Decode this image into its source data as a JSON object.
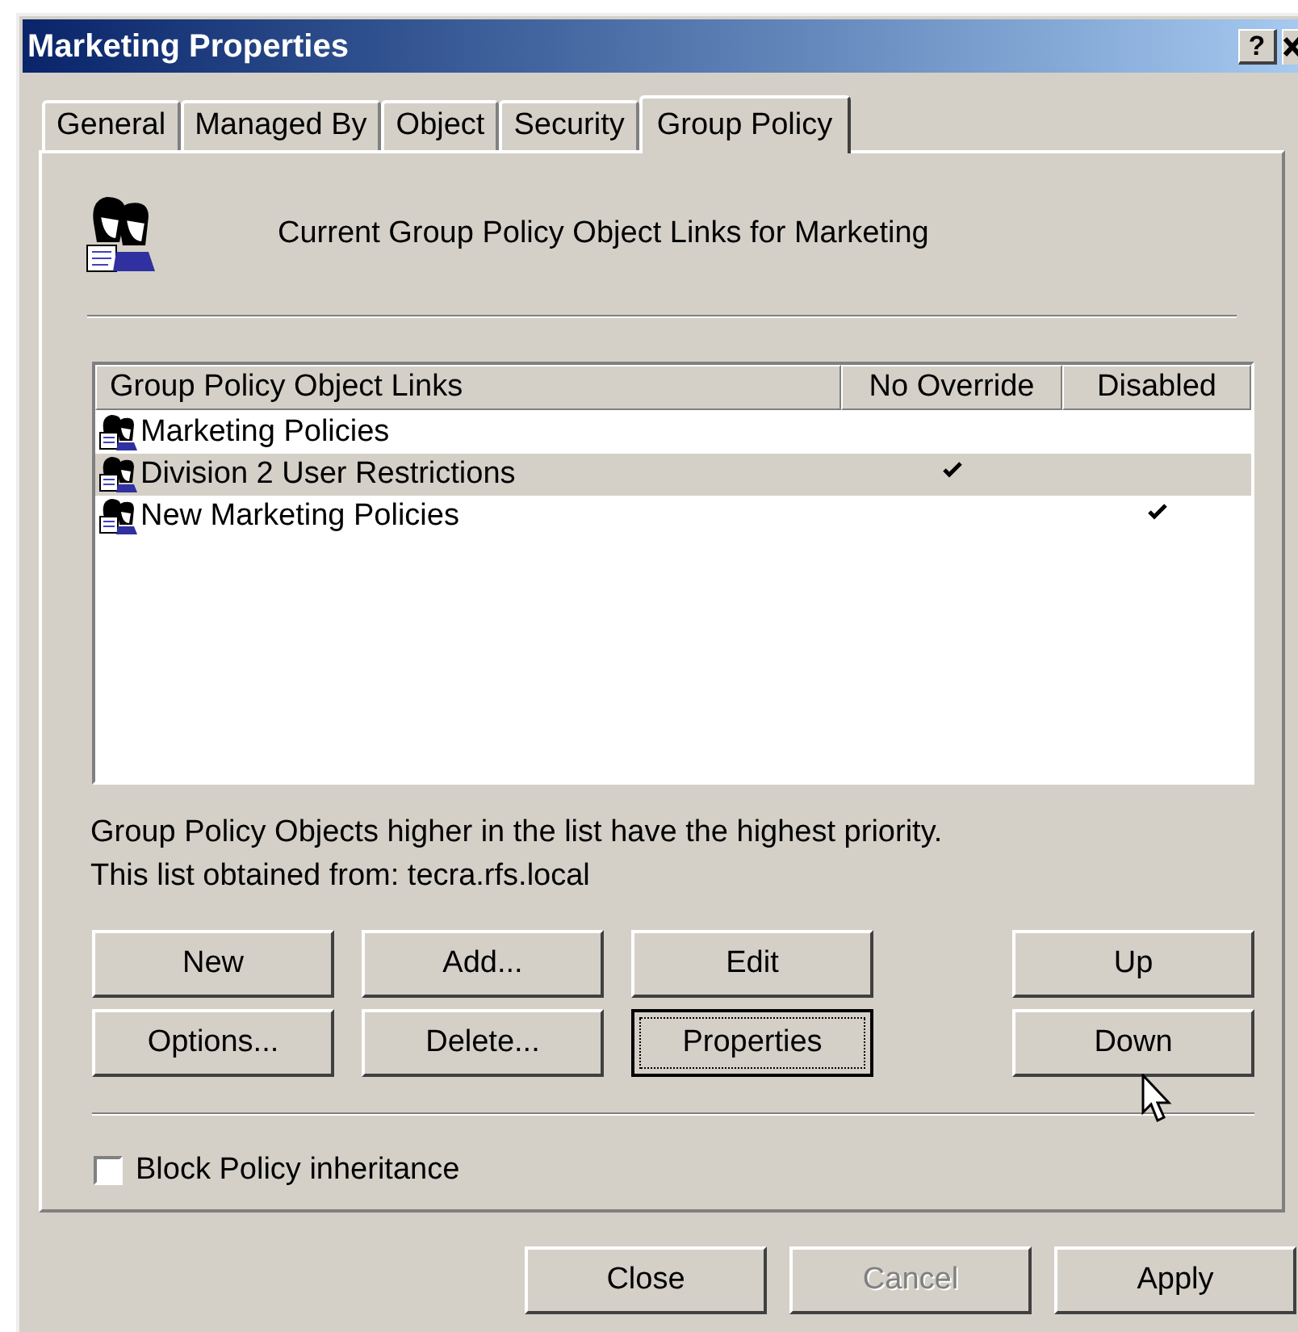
{
  "window": {
    "title": "Marketing Properties",
    "help_button": "?"
  },
  "tabs": [
    {
      "label": "General",
      "selected": false
    },
    {
      "label": "Managed By",
      "selected": false
    },
    {
      "label": "Object",
      "selected": false
    },
    {
      "label": "Security",
      "selected": false
    },
    {
      "label": "Group Policy",
      "selected": true
    }
  ],
  "heading": "Current Group Policy Object Links for Marketing",
  "table": {
    "columns": [
      "Group Policy Object Links",
      "No Override",
      "Disabled"
    ],
    "rows": [
      {
        "name": "Marketing Policies",
        "no_override": false,
        "disabled": false,
        "selected": false
      },
      {
        "name": "Division 2 User Restrictions",
        "no_override": true,
        "disabled": false,
        "selected": true
      },
      {
        "name": "New Marketing Policies",
        "no_override": false,
        "disabled": true,
        "selected": false
      }
    ]
  },
  "notes": [
    "Group Policy Objects higher in the list have the highest priority.",
    "This list obtained from: tecra.rfs.local"
  ],
  "buttons": [
    {
      "label": "New",
      "default": false
    },
    {
      "label": "Add...",
      "default": false
    },
    {
      "label": "Edit",
      "default": false
    },
    {
      "label": "Up",
      "default": false
    },
    {
      "label": "Options...",
      "default": false
    },
    {
      "label": "Delete...",
      "default": false
    },
    {
      "label": "Properties",
      "default": true
    },
    {
      "label": "Down",
      "default": false
    }
  ],
  "block_inheritance": {
    "label": "Block Policy inheritance",
    "checked": false
  },
  "dialog_buttons": [
    {
      "label": "Close",
      "disabled": false
    },
    {
      "label": "Cancel",
      "disabled": true
    },
    {
      "label": "Apply",
      "disabled": false
    }
  ]
}
